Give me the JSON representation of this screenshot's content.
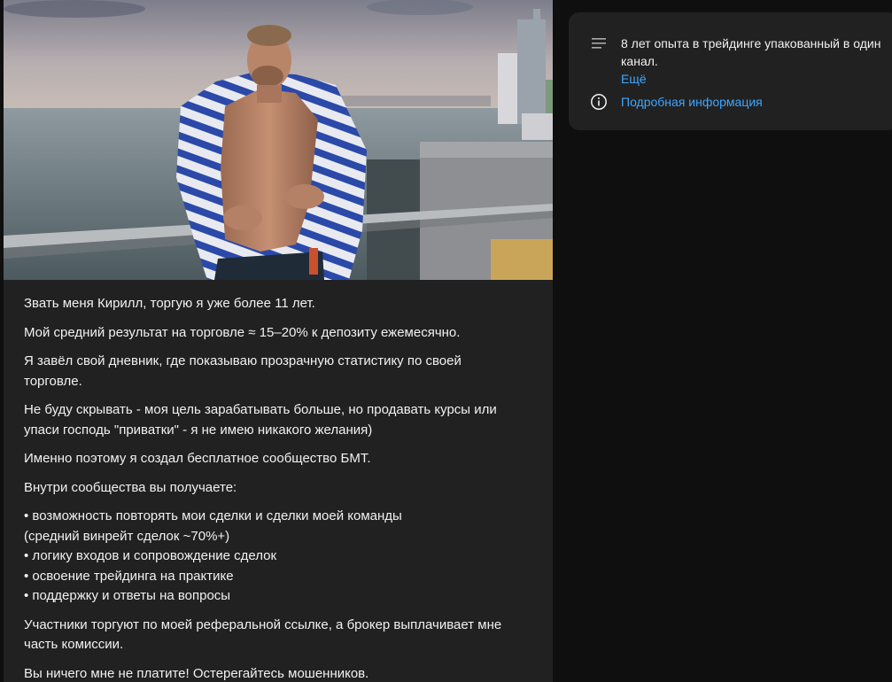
{
  "post": {
    "image_alt": "photo-man-with-towel-on-balcony",
    "paragraphs": [
      "Звать меня Кирилл, торгую я уже более 11 лет.",
      "Мой средний результат на торговле ≈ 15–20% к депозиту ежемесячно.",
      "Я завёл свой дневник, где показываю прозрачную статистику по своей\nторговле.",
      "Не буду скрывать - моя цель зарабатывать больше, но продавать курсы или\nупаси господь \"приватки\" - я не имею никакого желания)",
      "Именно поэтому я создал бесплатное сообщество БМТ.",
      "Внутри сообщества вы получаете:"
    ],
    "list_items": [
      "• возможность повторять мои сделки и сделки моей команды\n(средний винрейт сделок ~70%+)",
      "• логику входов и сопровождение сделок",
      "• освоение трейдинга на практике",
      "• поддержку и ответы на вопросы"
    ],
    "closing_paragraphs": [
      "Участники торгуют по моей реферальной ссылке, а брокер выплачивает мне\nчасть комиссии.",
      "Вы ничего мне не платите! Остерегайтесь мошенников."
    ]
  },
  "about": {
    "description": "8 лет опыта в трейдинге упакованный в один канал.",
    "more_label": "Ещё",
    "details_label": "Подробная информация",
    "description_icon": "description-lines-icon",
    "info_icon": "info-icon"
  },
  "colors": {
    "background": "#0f0f0f",
    "card": "#212121",
    "link": "#3ea6ff",
    "text": "#f1f1f1"
  }
}
